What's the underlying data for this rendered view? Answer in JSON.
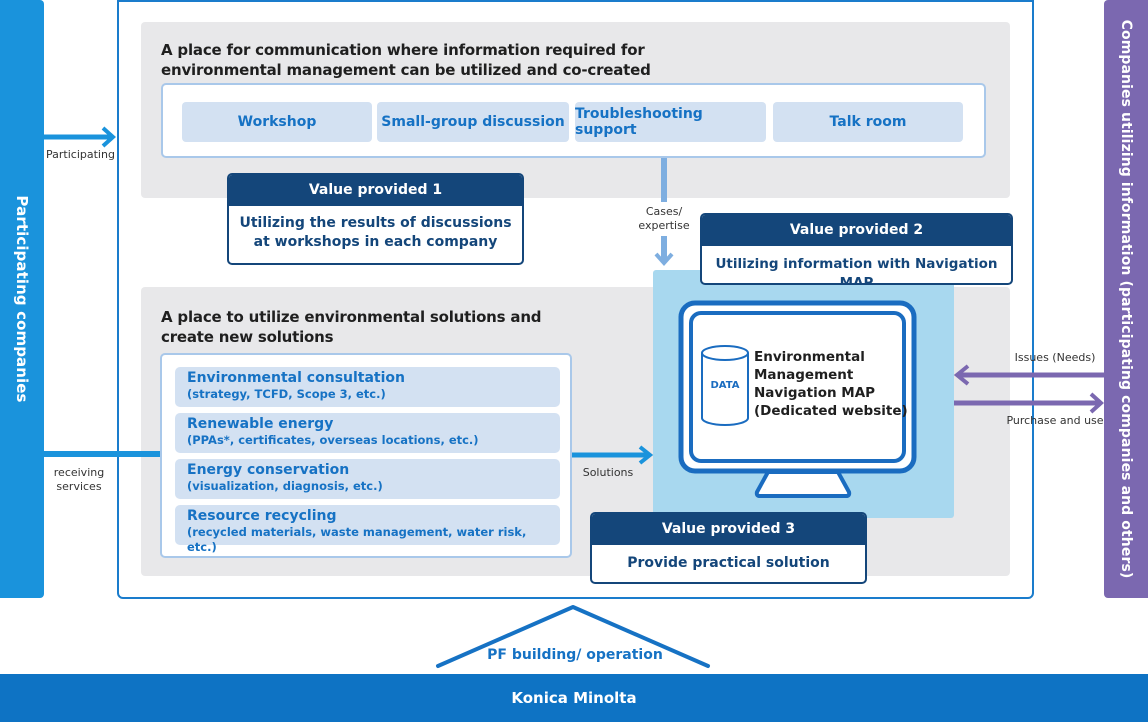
{
  "left_bar": {
    "label": "Participating companies"
  },
  "right_bar": {
    "label": "Companies utilizing information (participating companies and others)"
  },
  "flows": {
    "participating": "Participating",
    "receiving_services_line1": "receiving",
    "receiving_services_line2": "services",
    "cases_line1": "Cases/",
    "cases_line2": "expertise",
    "solutions": "Solutions",
    "issues": "Issues (Needs)",
    "purchase": "Purchase and use"
  },
  "communication_panel": {
    "title_line1": "A place for communication where information required for",
    "title_line2": "environmental management can be utilized and co-created",
    "activities": [
      "Workshop",
      "Small-group discussion",
      "Troubleshooting support",
      "Talk room"
    ]
  },
  "solutions_panel": {
    "title_line1": "A place to utilize environmental solutions and",
    "title_line2": "create new solutions",
    "items": [
      {
        "title": "Environmental consultation",
        "detail": "(strategy, TCFD, Scope 3, etc.)"
      },
      {
        "title": "Renewable energy",
        "detail": "(PPAs*, certificates, overseas locations, etc.)"
      },
      {
        "title": "Energy conservation",
        "detail": "(visualization, diagnosis, etc.)"
      },
      {
        "title": "Resource recycling",
        "detail": "(recycled materials, waste management, water risk, etc.)"
      }
    ]
  },
  "values": [
    {
      "heading": "Value provided 1",
      "line1": "Utilizing the results of discussions",
      "line2": "at workshops in each company"
    },
    {
      "heading": "Value provided 2",
      "line1": "Utilizing information with Navigation MAP",
      "line2": ""
    },
    {
      "heading": "Value provided 3",
      "line1": "Provide practical solution",
      "line2": ""
    }
  ],
  "navigation_map": {
    "data_label": "DATA",
    "line1": "Environmental",
    "line2": "Management",
    "line3": "Navigation MAP",
    "line4": "(Dedicated website)"
  },
  "foundation": {
    "roof_label": "PF building/ operation",
    "base_label": "Konica Minolta"
  },
  "colors": {
    "participant_blue": "#1a93dc",
    "user_purple": "#7b68b0",
    "navy": "#14467a",
    "accent_blue": "#1672c4",
    "chip_fill": "#d3e1f2",
    "panel_gray": "#e8e8ea",
    "monitor_bg": "#a8d8ef"
  }
}
